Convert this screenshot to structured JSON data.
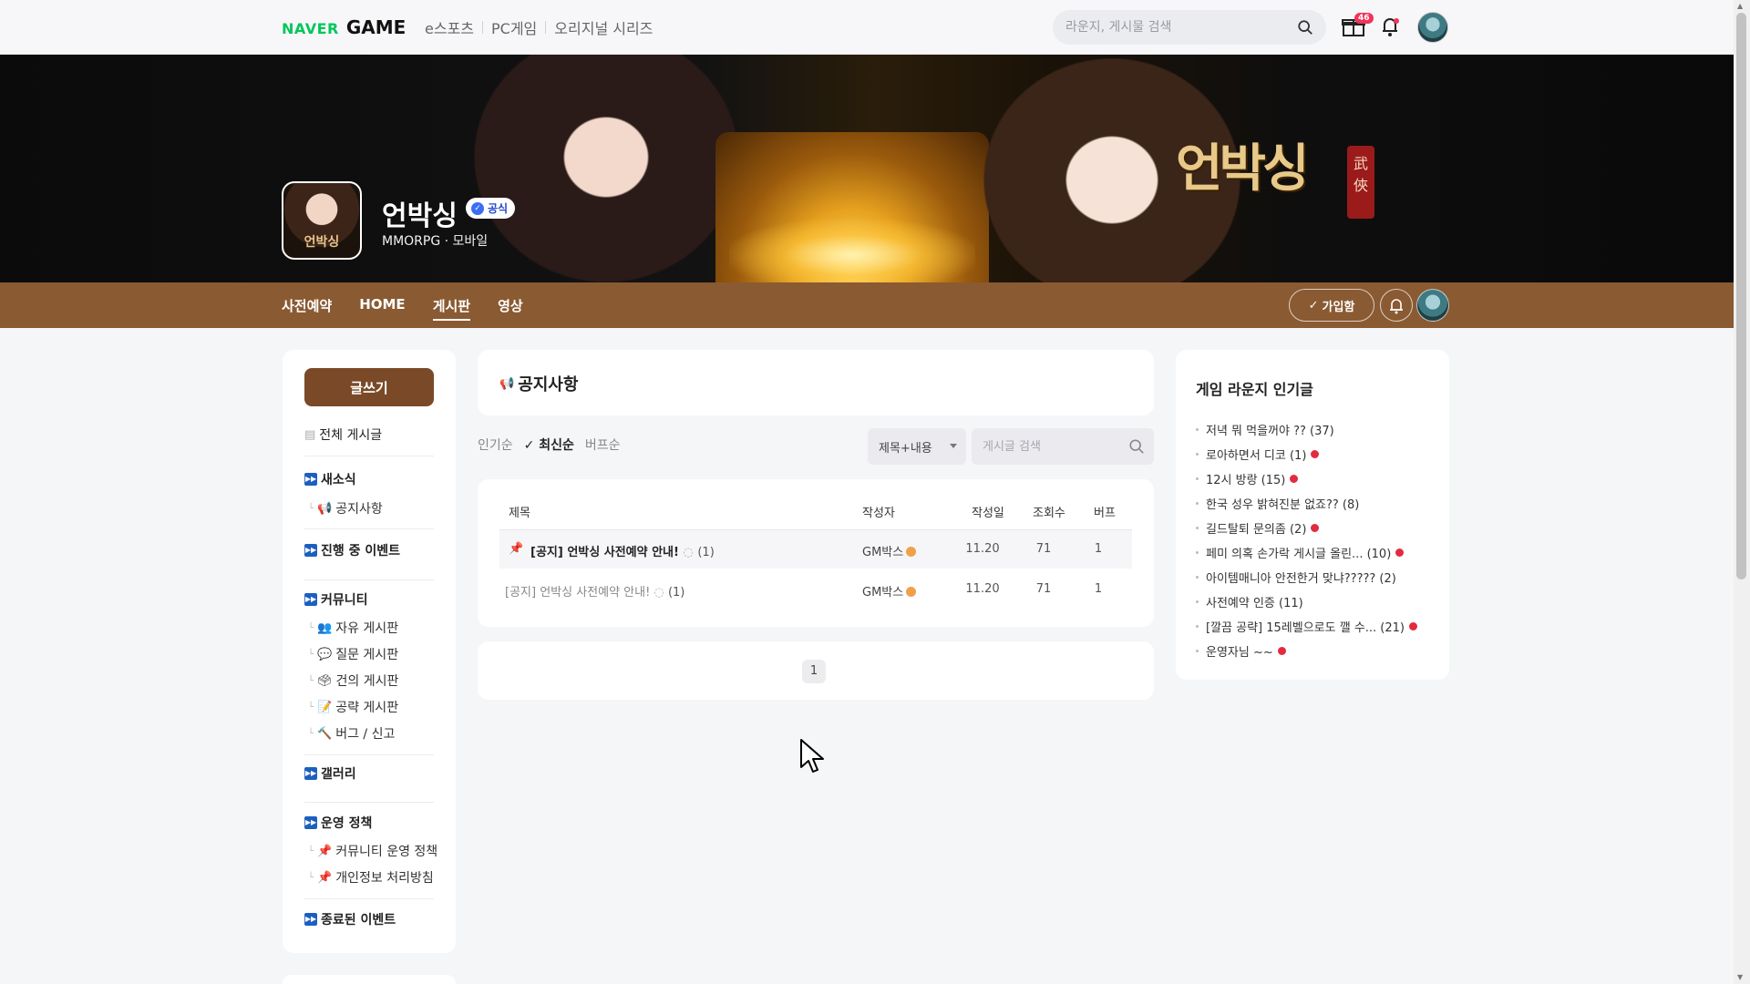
{
  "topbar": {
    "logo_naver": "NAVER",
    "logo_game": "GAME",
    "nav": [
      "e스포츠",
      "PC게임",
      "오리지널 시리즈"
    ],
    "search_placeholder": "라운지, 게시물 검색",
    "gift_badge": "46"
  },
  "banner": {
    "game_title": "언박싱",
    "official_label": "공식",
    "genre": "MMORPG · 모바일",
    "art_text": "언박싱",
    "seal_text": "武俠",
    "thumb_text": "언박싱"
  },
  "subnav": {
    "tabs": [
      "사전예약",
      "HOME",
      "게시판",
      "영상"
    ],
    "active_tab": "게시판",
    "join_label": "가입함"
  },
  "sidebar": {
    "write_label": "글쓰기",
    "all_posts": "전체 게시글",
    "sections": {
      "news": "새소식",
      "notice": "공지사항",
      "events": "진행 중 이벤트",
      "community": "커뮤니티",
      "free": "자유 게시판",
      "question": "질문 게시판",
      "suggestion": "건의 게시판",
      "guide": "공략 게시판",
      "bug": "버그 / 신고",
      "gallery": "갤러리",
      "policy": "운영 정책",
      "community_policy": "커뮤니티 운영 정책",
      "privacy": "개인정보 처리방침",
      "ended": "종료된 이벤트"
    }
  },
  "board": {
    "title": "공지사항",
    "sort": [
      "인기순",
      "최신순",
      "버프순"
    ],
    "active_sort": "최신순",
    "filter_select": "제목+내용",
    "search_placeholder": "게시글 검색",
    "columns": [
      "제목",
      "작성자",
      "작성일",
      "조회수",
      "버프"
    ],
    "rows": [
      {
        "title": "[공지] 언박싱 사전예약 안내!",
        "comments": "(1)",
        "author": "GM박스",
        "date": "11.20",
        "views": "71",
        "buff": "1",
        "pinned": true
      },
      {
        "title": "[공지] 언박싱 사전예약 안내!",
        "comments": "(1)",
        "author": "GM박스",
        "date": "11.20",
        "views": "71",
        "buff": "1",
        "pinned": false
      }
    ],
    "page": "1"
  },
  "popular": {
    "title": "게임 라운지 인기글",
    "items": [
      {
        "text": "저녁 뭐 먹을꺼야 ?? (37)",
        "new": false
      },
      {
        "text": "로아하면서 디코 (1)",
        "new": true
      },
      {
        "text": "12시 방랑 (15)",
        "new": true
      },
      {
        "text": "한국 성우 밝혀진분 없죠?? (8)",
        "new": false
      },
      {
        "text": "길드탈퇴 문의좀 (2)",
        "new": true
      },
      {
        "text": "페미 의혹 손가락 게시글 올린...   (10)",
        "new": true
      },
      {
        "text": "아이템매니아 안전한거 맞냐????? (2)",
        "new": false
      },
      {
        "text": "사전예약 인증 (11)",
        "new": false
      },
      {
        "text": "[깔끔 공략] 15레벨으로도 깰 수...  (21)",
        "new": true
      },
      {
        "text": "운영자님 ~~",
        "new": true
      }
    ]
  },
  "colors": {
    "brand_brown": "#8a5a32",
    "write_button": "#7a4a28",
    "naver_green": "#03c75a",
    "new_dot": "#e22b3f"
  }
}
